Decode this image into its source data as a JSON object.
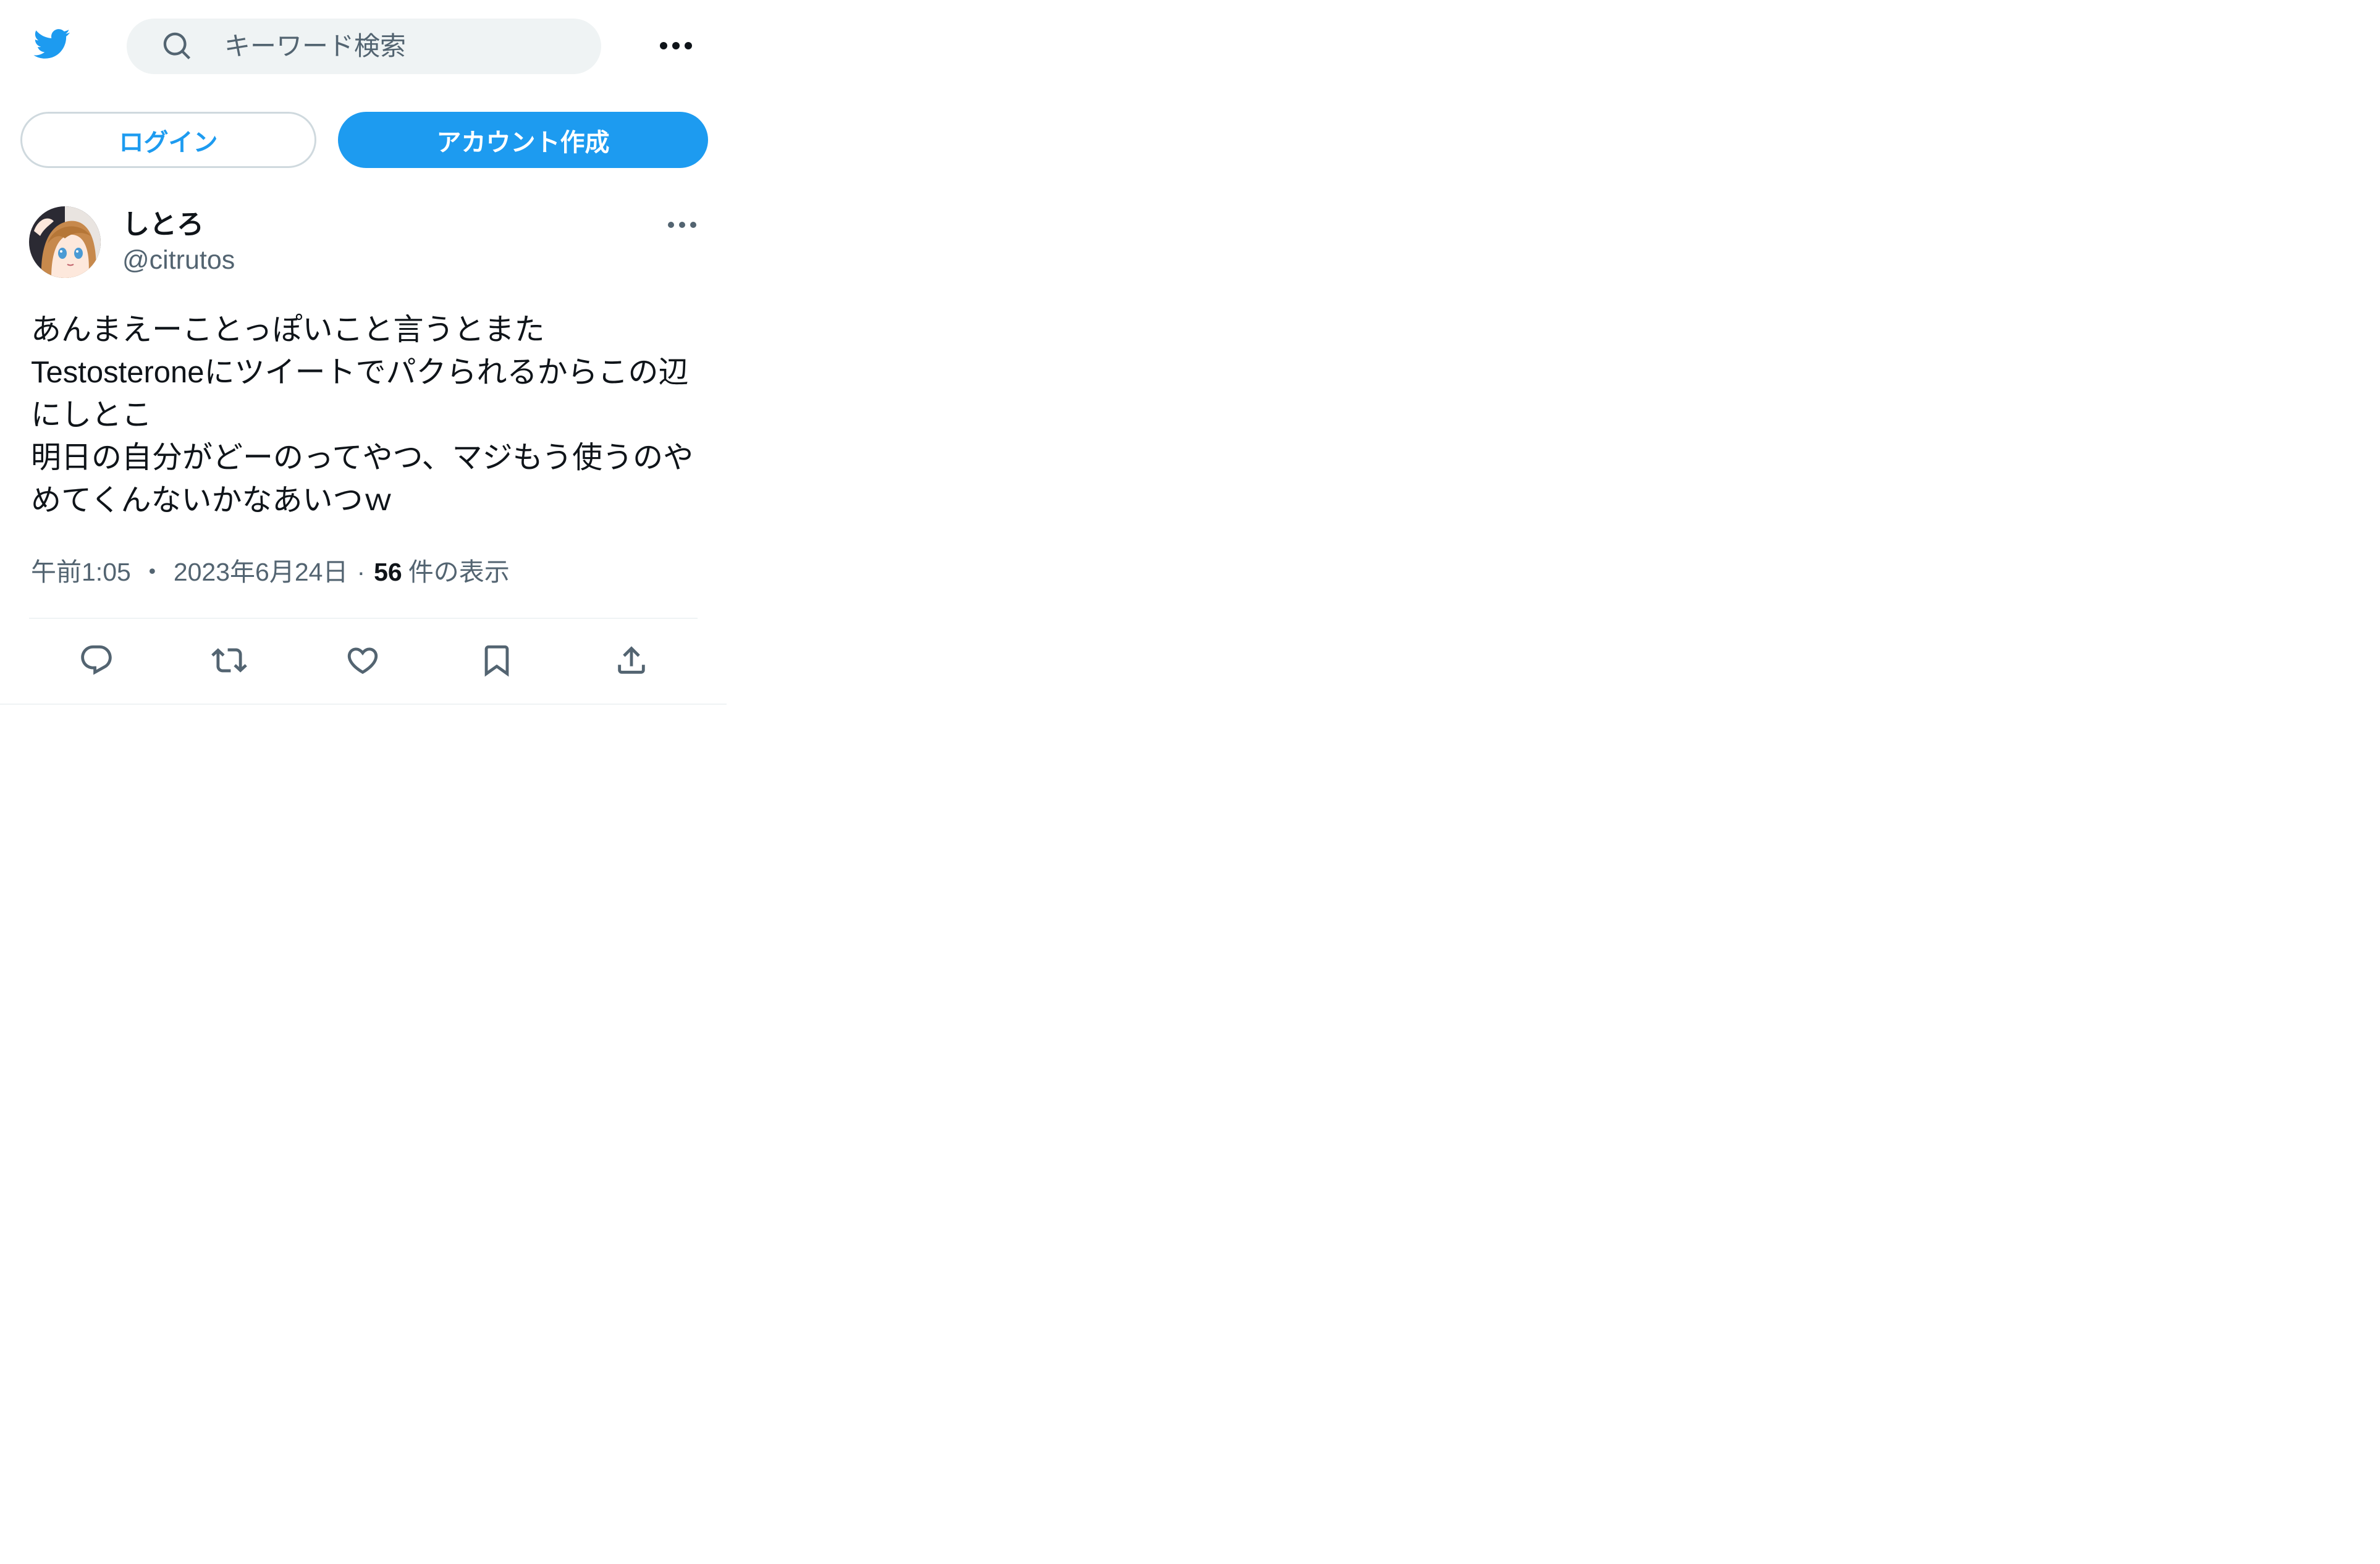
{
  "header": {
    "logo_icon": "twitter-bird-icon",
    "search": {
      "placeholder": "キーワード検索",
      "value": ""
    },
    "more_icon": "more-dots-icon"
  },
  "auth": {
    "login_label": "ログイン",
    "signup_label": "アカウント作成"
  },
  "tweet": {
    "author": {
      "name": "しとろ",
      "handle": "@citrutos"
    },
    "text_lines": [
      "あんまえーことっぽいこと言うとまた",
      "Testosteroneにツイートでパクられるからこの辺",
      "にしとこ",
      "明日の自分がどーのってやつ、マジもう使うのや",
      "めてくんないかなあいつｗ"
    ],
    "time": "午前1:05",
    "separator_1": "・",
    "date": "2023年6月24日",
    "separator_2": "·",
    "views_count": "56",
    "views_label": "件の表示",
    "actions": [
      "reply-icon",
      "retweet-icon",
      "like-icon",
      "bookmark-icon",
      "share-icon"
    ]
  },
  "colors": {
    "accent": "#1d9bf0",
    "text_primary": "#0f1419",
    "text_secondary": "#536471",
    "search_bg": "#eff3f4",
    "border": "#cfd9de"
  }
}
